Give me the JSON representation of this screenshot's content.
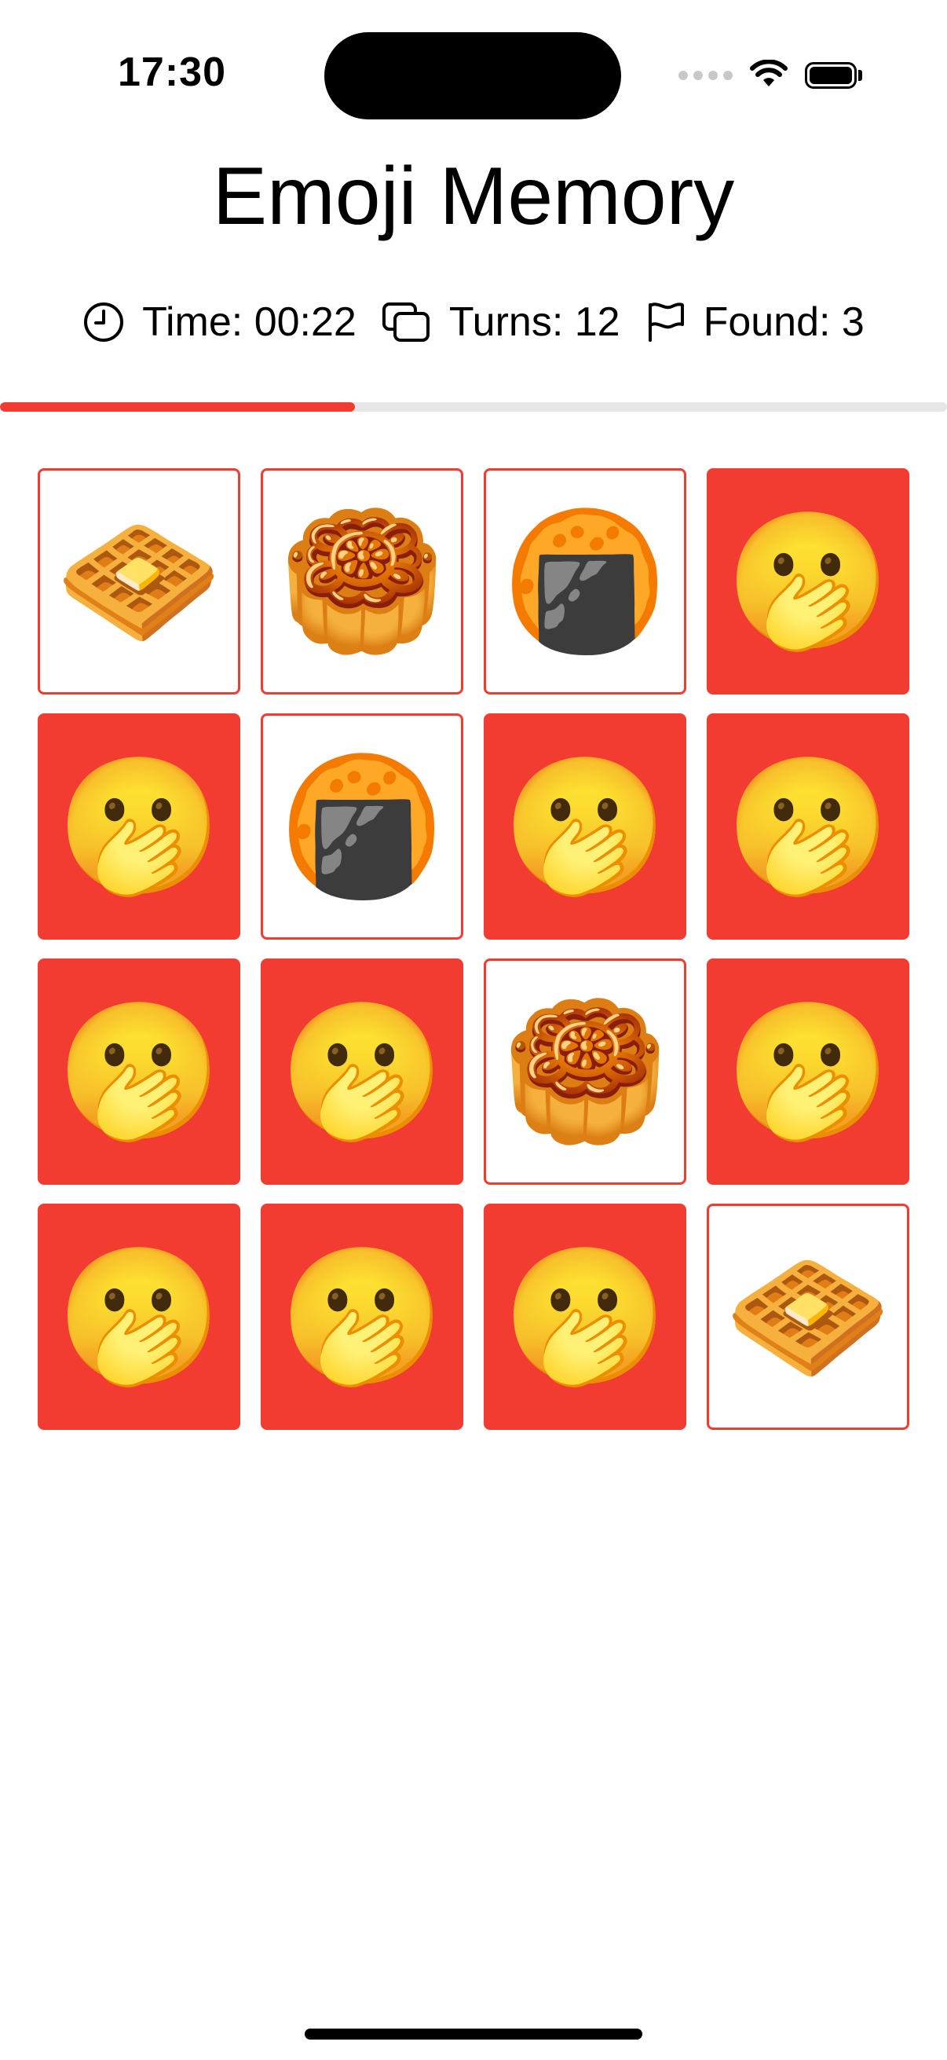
{
  "status_bar": {
    "time": "17:30"
  },
  "app": {
    "title": "Emoji Memory"
  },
  "stats": {
    "time_label": "Time: 00:22",
    "turns_label": "Turns: 12",
    "found_label": "Found: 3"
  },
  "progress": {
    "fraction": 0.375
  },
  "colors": {
    "accent": "#f23c32",
    "track": "#e6e6e6"
  },
  "cards": [
    {
      "state": "face-up",
      "emoji": "🧇",
      "name": "waffle"
    },
    {
      "state": "face-up",
      "emoji": "🥮",
      "name": "moon-cake"
    },
    {
      "state": "face-up",
      "emoji": "🍘",
      "name": "rice-cracker"
    },
    {
      "state": "face-down",
      "emoji": "🫢",
      "name": "face-with-hand-over-mouth"
    },
    {
      "state": "face-down",
      "emoji": "🫢",
      "name": "face-with-hand-over-mouth"
    },
    {
      "state": "face-up",
      "emoji": "🍘",
      "name": "rice-cracker"
    },
    {
      "state": "face-down",
      "emoji": "🫢",
      "name": "face-with-hand-over-mouth"
    },
    {
      "state": "face-down",
      "emoji": "🫢",
      "name": "face-with-hand-over-mouth"
    },
    {
      "state": "face-down",
      "emoji": "🫢",
      "name": "face-with-hand-over-mouth"
    },
    {
      "state": "face-down",
      "emoji": "🫢",
      "name": "face-with-hand-over-mouth"
    },
    {
      "state": "face-up",
      "emoji": "🥮",
      "name": "moon-cake"
    },
    {
      "state": "face-down",
      "emoji": "🫢",
      "name": "face-with-hand-over-mouth"
    },
    {
      "state": "face-down",
      "emoji": "🫢",
      "name": "face-with-hand-over-mouth"
    },
    {
      "state": "face-down",
      "emoji": "🫢",
      "name": "face-with-hand-over-mouth"
    },
    {
      "state": "face-down",
      "emoji": "🫢",
      "name": "face-with-hand-over-mouth"
    },
    {
      "state": "face-up",
      "emoji": "🧇",
      "name": "waffle"
    }
  ]
}
